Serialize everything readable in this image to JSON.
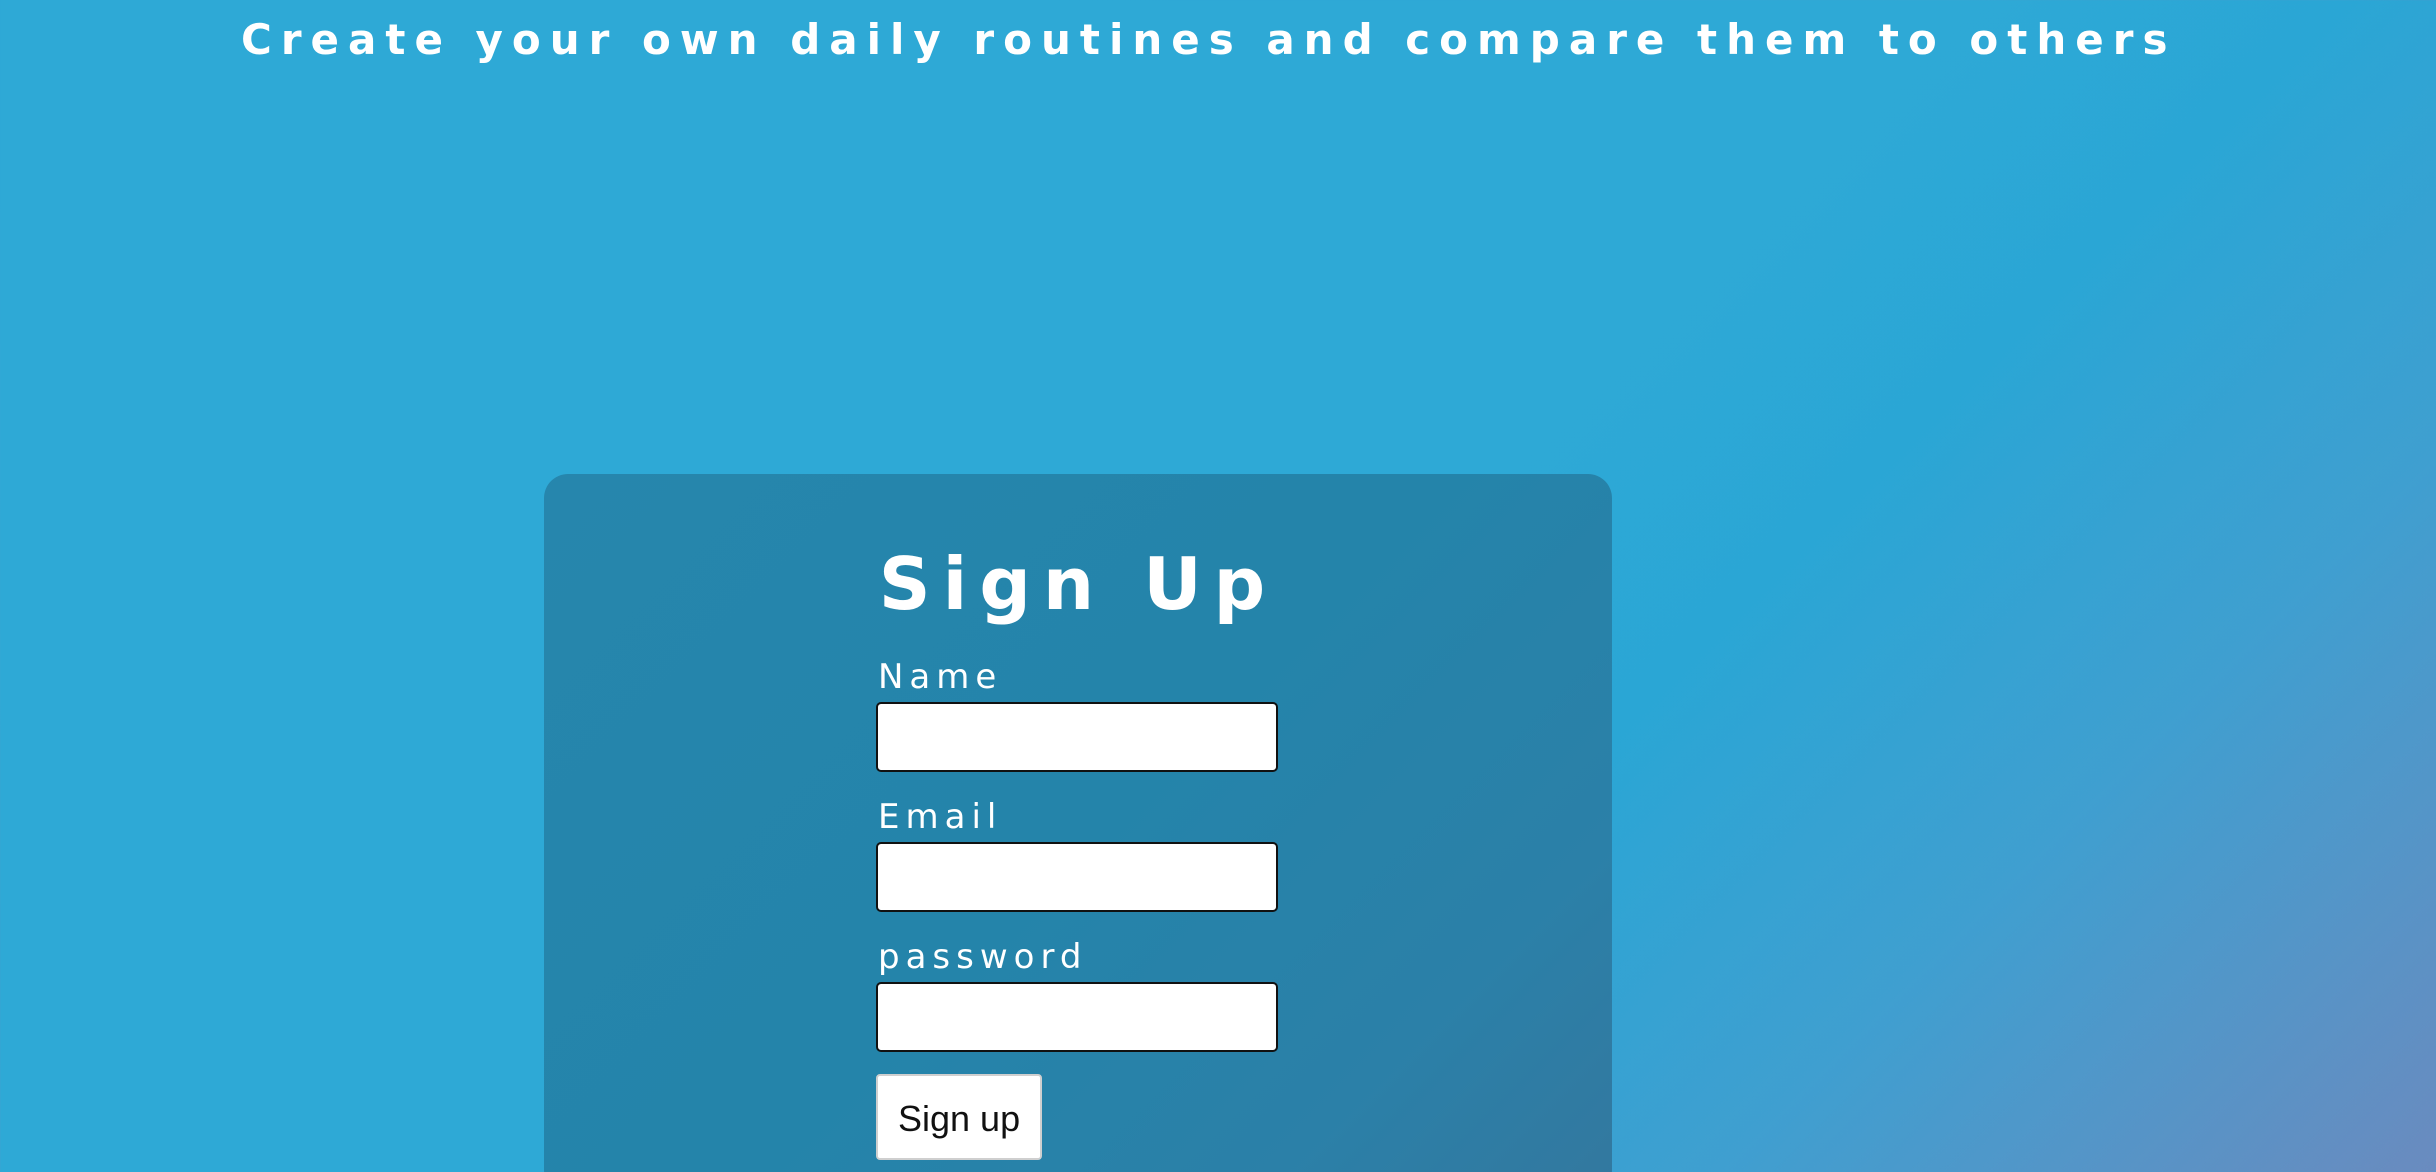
{
  "header": {
    "tagline": "Create your own daily routines and compare them to others"
  },
  "signup_card": {
    "title": "Sign Up",
    "fields": {
      "name": {
        "label": "Name",
        "value": "",
        "placeholder": ""
      },
      "email": {
        "label": "Email",
        "value": "",
        "placeholder": ""
      },
      "password": {
        "label": "password",
        "value": "",
        "placeholder": ""
      }
    },
    "submit_label": "Sign up"
  },
  "colors": {
    "page_background": "#2ea9d6",
    "card_background": "#2686ad",
    "text": "#ffffff",
    "input_background": "#ffffff"
  }
}
